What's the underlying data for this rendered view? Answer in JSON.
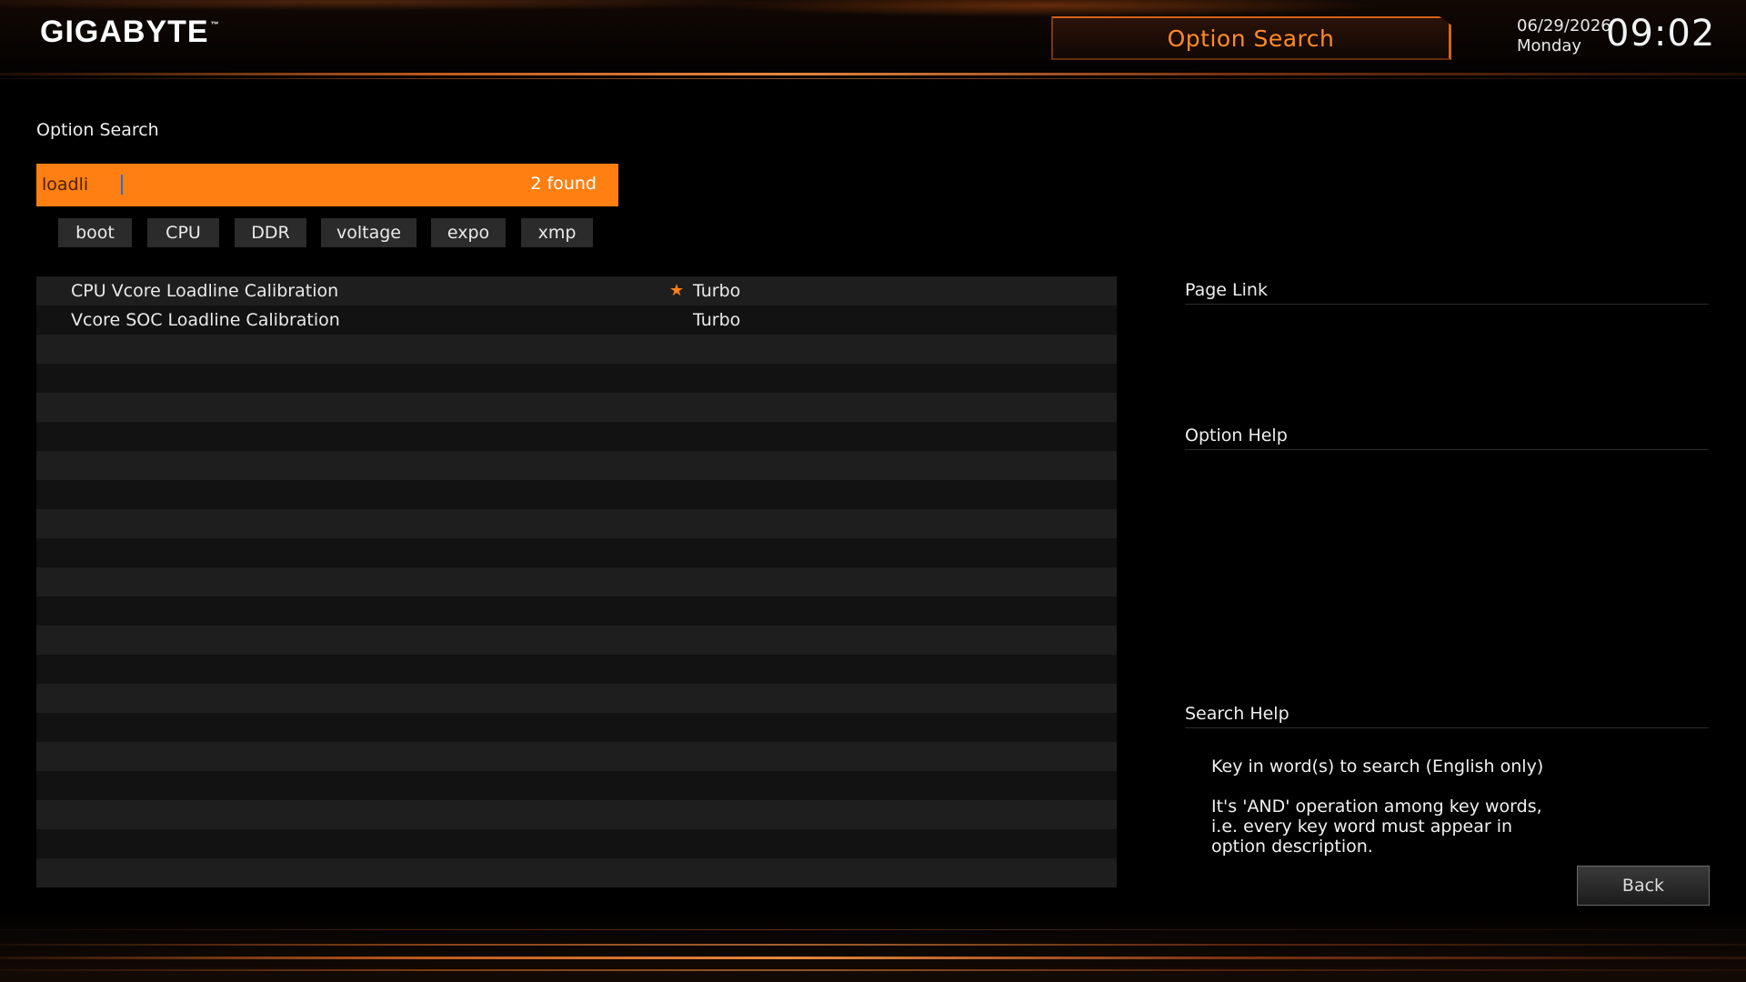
{
  "header": {
    "logo": "GIGABYTE",
    "logo_tm": "™",
    "title": "Option Search",
    "date": "06/29/2026",
    "weekday": "Monday",
    "time": "09:02"
  },
  "search": {
    "section_title": "Option Search",
    "query": "loadli",
    "found_count": "2 found",
    "chips": [
      "boot",
      "CPU",
      "DDR",
      "voltage",
      "expo",
      "xmp"
    ]
  },
  "results": [
    {
      "name": "CPU Vcore Loadline Calibration",
      "value": "Turbo",
      "starred": true
    },
    {
      "name": "Vcore SOC Loadline Calibration",
      "value": "Turbo",
      "starred": false
    }
  ],
  "side": {
    "page_link_title": "Page Link",
    "option_help_title": "Option Help",
    "search_help_title": "Search Help",
    "search_help_line1": "Key in word(s) to search (English only)",
    "search_help_line2": "It's 'AND' operation among key words,",
    "search_help_line3": "i.e. every key word must appear in",
    "search_help_line4": "option description."
  },
  "back_label": "Back",
  "colors": {
    "accent": "#ff7f12",
    "row_odd": "#1e1e1e",
    "row_even": "#121212"
  },
  "icons": {
    "favorite": "star-icon"
  }
}
